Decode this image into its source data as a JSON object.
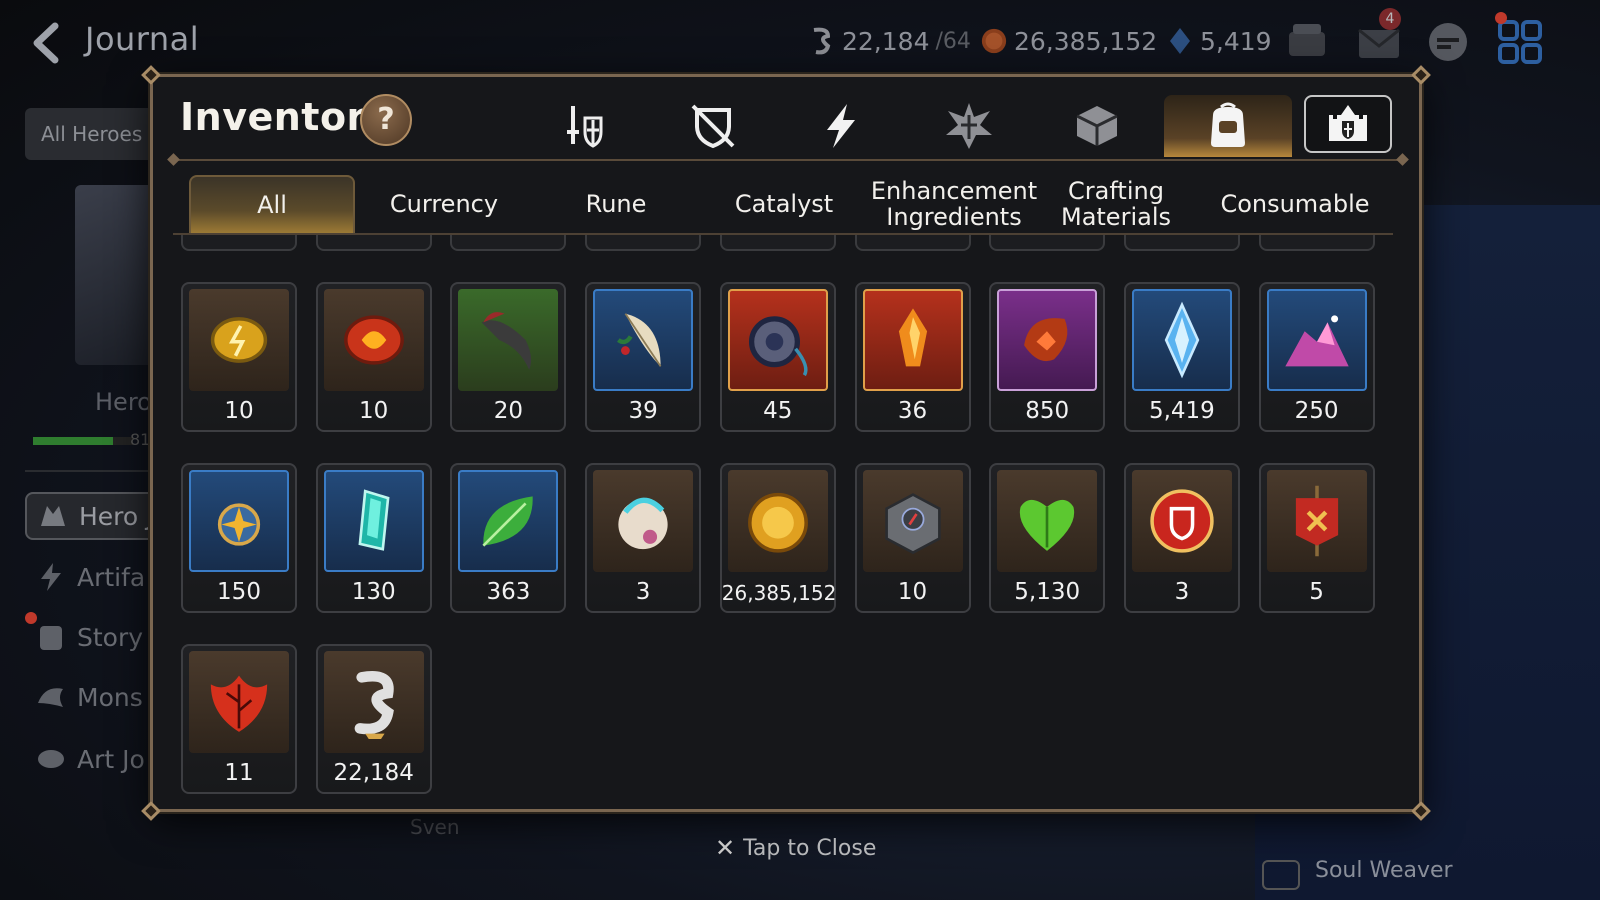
{
  "topbar": {
    "title": "Journal",
    "resources": [
      {
        "name": "skystone",
        "value": "22,184",
        "suffix": "/64"
      },
      {
        "name": "gold",
        "value": "26,385,152",
        "suffix": ""
      },
      {
        "name": "mystic",
        "value": "5,419",
        "suffix": ""
      }
    ],
    "mail_badge": "4"
  },
  "left_panel": {
    "filter_label": "All Heroes",
    "hero_label": "Hero",
    "progress": 0.8,
    "progress_text": "81",
    "menu": [
      {
        "label": "Hero J",
        "icon": "hero-icon"
      },
      {
        "label": "Artifa",
        "icon": "artifact-icon"
      },
      {
        "label": "Story",
        "icon": "story-icon"
      },
      {
        "label": "Mons",
        "icon": "monster-icon"
      },
      {
        "label": "Art Jo",
        "icon": "art-icon"
      }
    ]
  },
  "background_labels": {
    "sven": "Sven",
    "soul_weaver": "Soul Weaver"
  },
  "modal": {
    "title": "Inventory",
    "help_label": "?",
    "category_tabs": [
      {
        "name": "equipment",
        "icon": "sword-shield-icon"
      },
      {
        "name": "equipment-locked",
        "icon": "crossed-shield-icon"
      },
      {
        "name": "artifact",
        "icon": "lightning-icon"
      },
      {
        "name": "specialty",
        "icon": "emblem-icon"
      },
      {
        "name": "materials",
        "icon": "cube-icon"
      },
      {
        "name": "items",
        "icon": "backpack-icon",
        "active": true
      },
      {
        "name": "storage",
        "icon": "fortress-icon"
      }
    ],
    "subtabs": [
      {
        "label": "All",
        "active": true
      },
      {
        "label": "Currency"
      },
      {
        "label": "Rune"
      },
      {
        "label": "Catalyst"
      },
      {
        "label": "Enhancement\nIngredients"
      },
      {
        "label": "Crafting\nMaterials"
      },
      {
        "label": "Consumable"
      }
    ],
    "items": [
      {
        "qty": "10",
        "icon": "yellow-rune-icon",
        "bg": "brown"
      },
      {
        "qty": "10",
        "icon": "red-rune-icon",
        "bg": "brown"
      },
      {
        "qty": "20",
        "icon": "claw-icon",
        "bg": "green"
      },
      {
        "qty": "39",
        "icon": "feather-icon",
        "bg": "blue"
      },
      {
        "qty": "45",
        "icon": "pendant-icon",
        "bg": "red"
      },
      {
        "qty": "36",
        "icon": "flame-crystal-icon",
        "bg": "red"
      },
      {
        "qty": "850",
        "icon": "horn-icon",
        "bg": "purple"
      },
      {
        "qty": "5,419",
        "icon": "mystic-medal-icon",
        "bg": "blue"
      },
      {
        "qty": "250",
        "icon": "crystal-pile-icon",
        "bg": "blue"
      },
      {
        "qty": "150",
        "icon": "star-amulet-icon",
        "bg": "blue"
      },
      {
        "qty": "130",
        "icon": "teal-crystal-icon",
        "bg": "blue"
      },
      {
        "qty": "363",
        "icon": "leaf-icon",
        "bg": "blue"
      },
      {
        "qty": "3",
        "icon": "pet-orb-icon",
        "bg": "brown"
      },
      {
        "qty": "26,385,152",
        "icon": "gold-coin-icon",
        "bg": "brown"
      },
      {
        "qty": "10",
        "icon": "compass-box-icon",
        "bg": "brown"
      },
      {
        "qty": "5,130",
        "icon": "green-heart-icon",
        "bg": "brown"
      },
      {
        "qty": "3",
        "icon": "guild-seal-icon",
        "bg": "brown"
      },
      {
        "qty": "5",
        "icon": "banner-icon",
        "bg": "brown"
      },
      {
        "qty": "11",
        "icon": "red-leaf-icon",
        "bg": "brown"
      },
      {
        "qty": "22,184",
        "icon": "skystone-icon",
        "bg": "brown"
      }
    ]
  },
  "close_label": "Tap to Close",
  "colors": {
    "accent": "#b6883c",
    "frame": "#7a6650",
    "panel": "#16171a"
  }
}
